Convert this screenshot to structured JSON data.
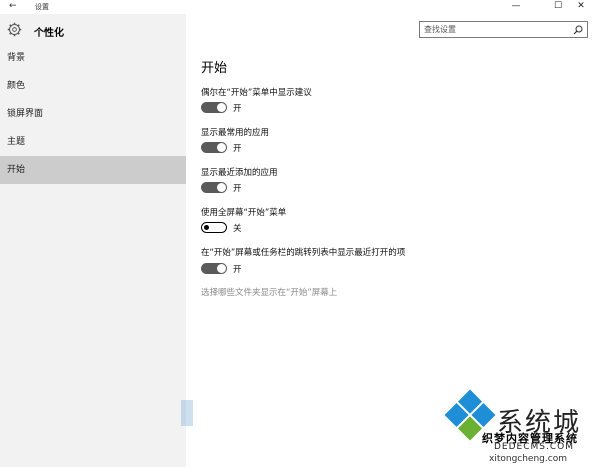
{
  "window": {
    "title": "设置",
    "back_glyph": "←",
    "minimize_glyph": "—",
    "maximize_glyph": "☐",
    "close_glyph": "✕"
  },
  "sidebar": {
    "title": "个性化",
    "icon": "gear-icon",
    "items": [
      {
        "label": "背景"
      },
      {
        "label": "颜色"
      },
      {
        "label": "锁屏界面"
      },
      {
        "label": "主题"
      },
      {
        "label": "开始",
        "active": true
      }
    ]
  },
  "search": {
    "placeholder": "查找设置",
    "icon": "search-icon"
  },
  "main": {
    "title": "开始",
    "settings": [
      {
        "label": "偶尔在“开始”菜单中显示建议",
        "state": "开",
        "on": true
      },
      {
        "label": "显示最常用的应用",
        "state": "开",
        "on": true
      },
      {
        "label": "显示最近添加的应用",
        "state": "开",
        "on": true
      },
      {
        "label": "使用全屏幕“开始”菜单",
        "state": "关",
        "on": false
      },
      {
        "label": "在“开始”屏幕或任务栏的跳转列表中显示最近打开的项",
        "state": "开",
        "on": true
      }
    ],
    "link": "选择哪些文件夹显示在“开始”屏幕上"
  },
  "watermark": {
    "brand": "系统城",
    "line1": "织梦内容管理系统",
    "line2": "DEDECMS.COM",
    "line3": "xitongcheng.com",
    "colors": {
      "blue": "#1e8fd6",
      "green": "#6ab033"
    }
  },
  "colors": {
    "sidebar_bg": "#f2f2f2",
    "active_item_bg": "#cccccc",
    "toggle_on": "#5a5a5a"
  }
}
